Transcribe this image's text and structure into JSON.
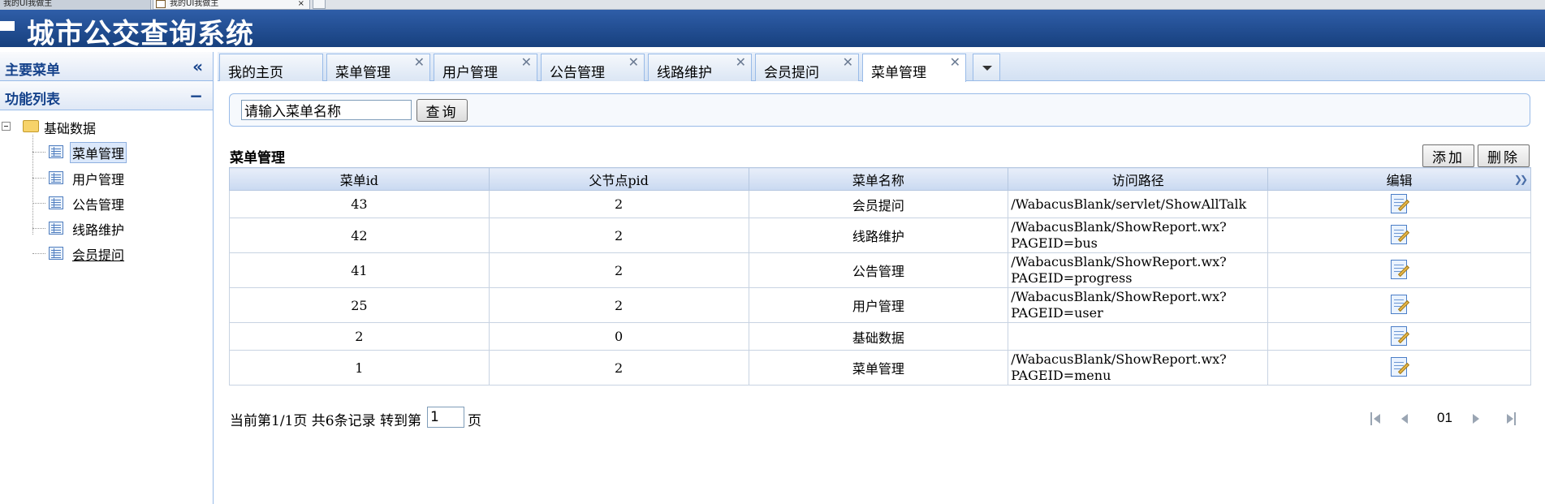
{
  "browser": {
    "tabs": [
      {
        "label": "我的UI我做主"
      },
      {
        "label": "我的UI我做主",
        "close": "×"
      }
    ]
  },
  "app": {
    "title": "城市公交查询系统"
  },
  "sidebar": {
    "main_menu_title": "主要菜单",
    "collapse_symbol": "«",
    "function_list_title": "功能列表",
    "function_list_toggle": "−",
    "tree": {
      "root_label": "基础数据",
      "items": [
        {
          "label": "菜单管理",
          "selected": true
        },
        {
          "label": "用户管理"
        },
        {
          "label": "公告管理"
        },
        {
          "label": "线路维护"
        },
        {
          "label": "会员提问"
        }
      ]
    }
  },
  "tabs": [
    {
      "label": "我的主页",
      "closable": false
    },
    {
      "label": "菜单管理",
      "closable": true
    },
    {
      "label": "用户管理",
      "closable": true
    },
    {
      "label": "公告管理",
      "closable": true
    },
    {
      "label": "线路维护",
      "closable": true
    },
    {
      "label": "会员提问",
      "closable": true
    },
    {
      "label": "菜单管理",
      "closable": true,
      "active": true
    }
  ],
  "search": {
    "value": "请输入菜单名称",
    "button_label": "查询"
  },
  "report": {
    "title": "菜单管理",
    "add_label": "添加",
    "delete_label": "删除",
    "columns": [
      "菜单id",
      "父节点pid",
      "菜单名称",
      "访问路径",
      "编辑"
    ],
    "rows": [
      {
        "id": "43",
        "pid": "2",
        "name": "会员提问",
        "path": [
          "/WabacusBlank/servlet/ShowAllTalk"
        ]
      },
      {
        "id": "42",
        "pid": "2",
        "name": "线路维护",
        "path": [
          "/WabacusBlank/ShowReport.wx?",
          "PAGEID=bus"
        ]
      },
      {
        "id": "41",
        "pid": "2",
        "name": "公告管理",
        "path": [
          "/WabacusBlank/ShowReport.wx?",
          "PAGEID=progress"
        ]
      },
      {
        "id": "25",
        "pid": "2",
        "name": "用户管理",
        "path": [
          "/WabacusBlank/ShowReport.wx?",
          "PAGEID=user"
        ]
      },
      {
        "id": "2",
        "pid": "0",
        "name": "基础数据",
        "path": []
      },
      {
        "id": "1",
        "pid": "2",
        "name": "菜单管理",
        "path": [
          "/WabacusBlank/ShowReport.wx?",
          "PAGEID=menu"
        ]
      }
    ]
  },
  "pager": {
    "summary": "当前第1/1页 共6条记录 转到第",
    "page_value": "1",
    "suffix": "页",
    "current_page": "01"
  },
  "colors": {
    "banner": "#17407e",
    "panel_title": "#15428b",
    "border": "#99bbe8"
  },
  "icons": [
    "folder-icon",
    "document-grid-icon",
    "edit-icon",
    "first-page-icon",
    "prev-page-icon",
    "next-page-icon",
    "last-page-icon",
    "expand-columns-icon",
    "close-icon",
    "dropdown-arrow-icon"
  ]
}
